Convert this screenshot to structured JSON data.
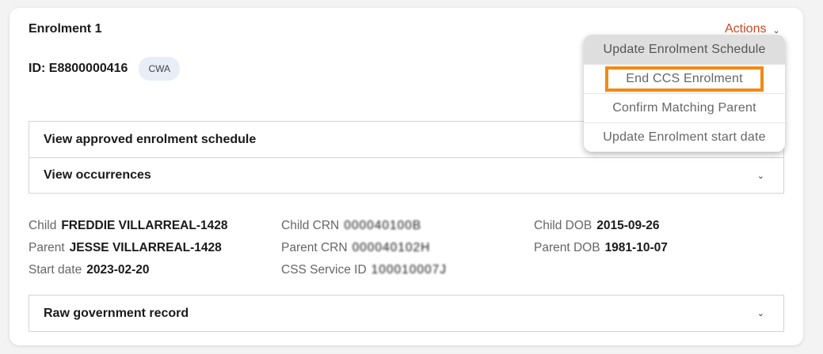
{
  "card": {
    "title": "Enrolment 1",
    "actions_label": "Actions",
    "id_label": "ID: E8800000416",
    "badge": "CWA"
  },
  "panels": {
    "schedule": "View approved enrolment schedule",
    "occurrences": "View occurrences",
    "raw_record": "Raw government record"
  },
  "details": {
    "child_label": "Child",
    "child_value": "FREDDIE VILLARREAL-1428",
    "parent_label": "Parent",
    "parent_value": "JESSE VILLARREAL-1428",
    "start_label": "Start date",
    "start_value": "2023-02-20",
    "child_crn_label": "Child CRN",
    "child_crn_value": "000040100B",
    "parent_crn_label": "Parent CRN",
    "parent_crn_value": "000040102H",
    "css_label": "CSS Service ID",
    "css_value": "100010007J",
    "child_dob_label": "Child DOB",
    "child_dob_value": "2015-09-26",
    "parent_dob_label": "Parent DOB",
    "parent_dob_value": "1981-10-07"
  },
  "actions_menu": {
    "items": [
      "Update Enrolment Schedule",
      "End CCS Enrolment",
      "Confirm Matching Parent",
      "Update Enrolment start date"
    ],
    "hovered_index": 0,
    "focused_index": 1
  },
  "colors": {
    "accent": "#d2461e",
    "focus_outline": "#f28a14",
    "badge_bg": "#e7eef6"
  },
  "icons": {
    "chevron": "chevron-down-icon"
  }
}
